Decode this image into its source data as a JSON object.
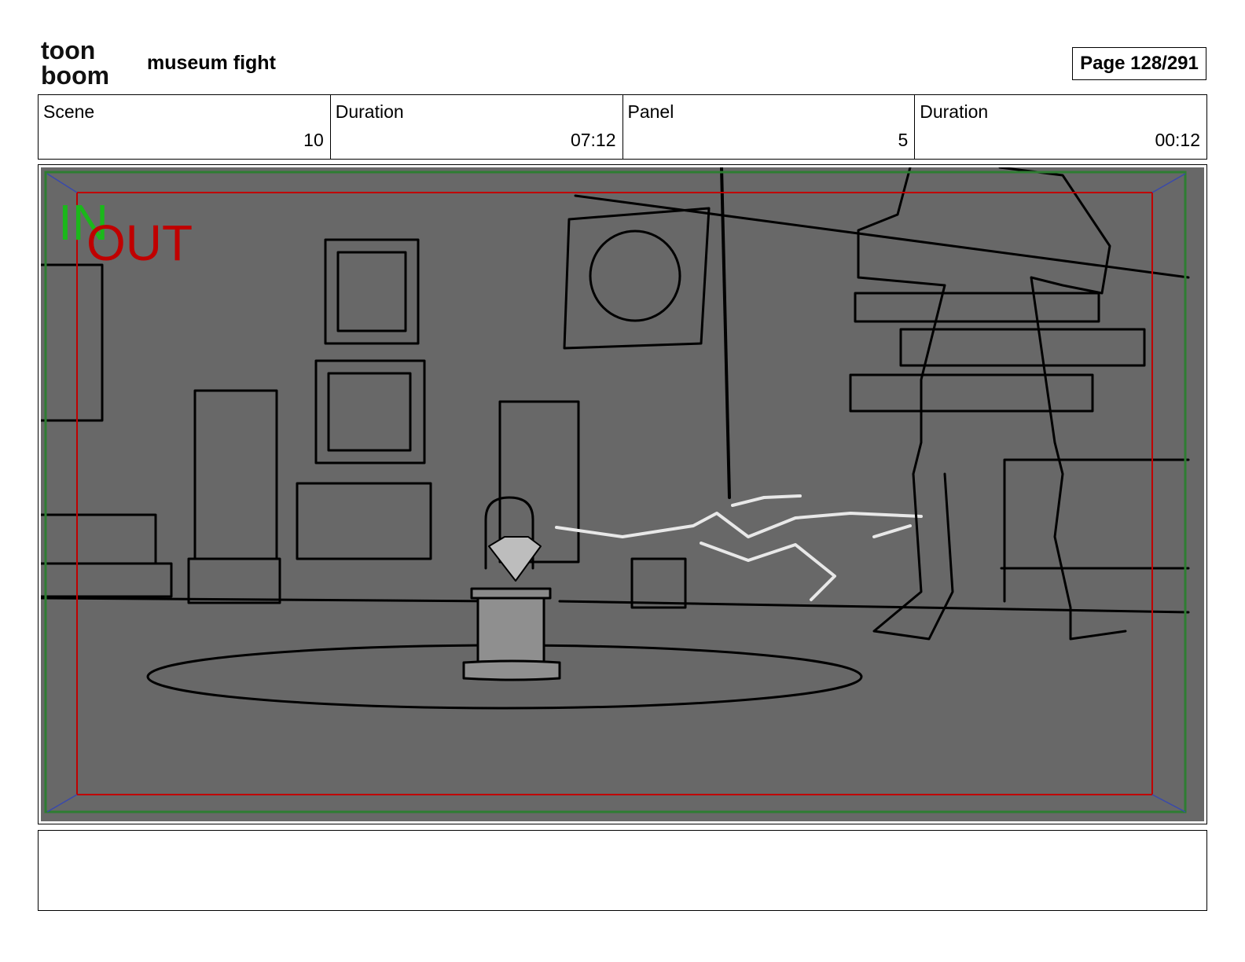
{
  "header": {
    "logo_line1": "toon",
    "logo_line2": "boom",
    "project_title": "museum fight",
    "page_label": "Page 128/291"
  },
  "info": [
    {
      "label": "Scene",
      "value": "10"
    },
    {
      "label": "Duration",
      "value": "07:12"
    },
    {
      "label": "Panel",
      "value": "5"
    },
    {
      "label": "Duration",
      "value": "00:12"
    }
  ],
  "panel": {
    "in_label": "IN",
    "out_label": "OUT",
    "background_color": "#686868",
    "in_frame_color": "#2e7d32",
    "out_frame_color": "#c00000"
  },
  "notes": {
    "text": ""
  }
}
